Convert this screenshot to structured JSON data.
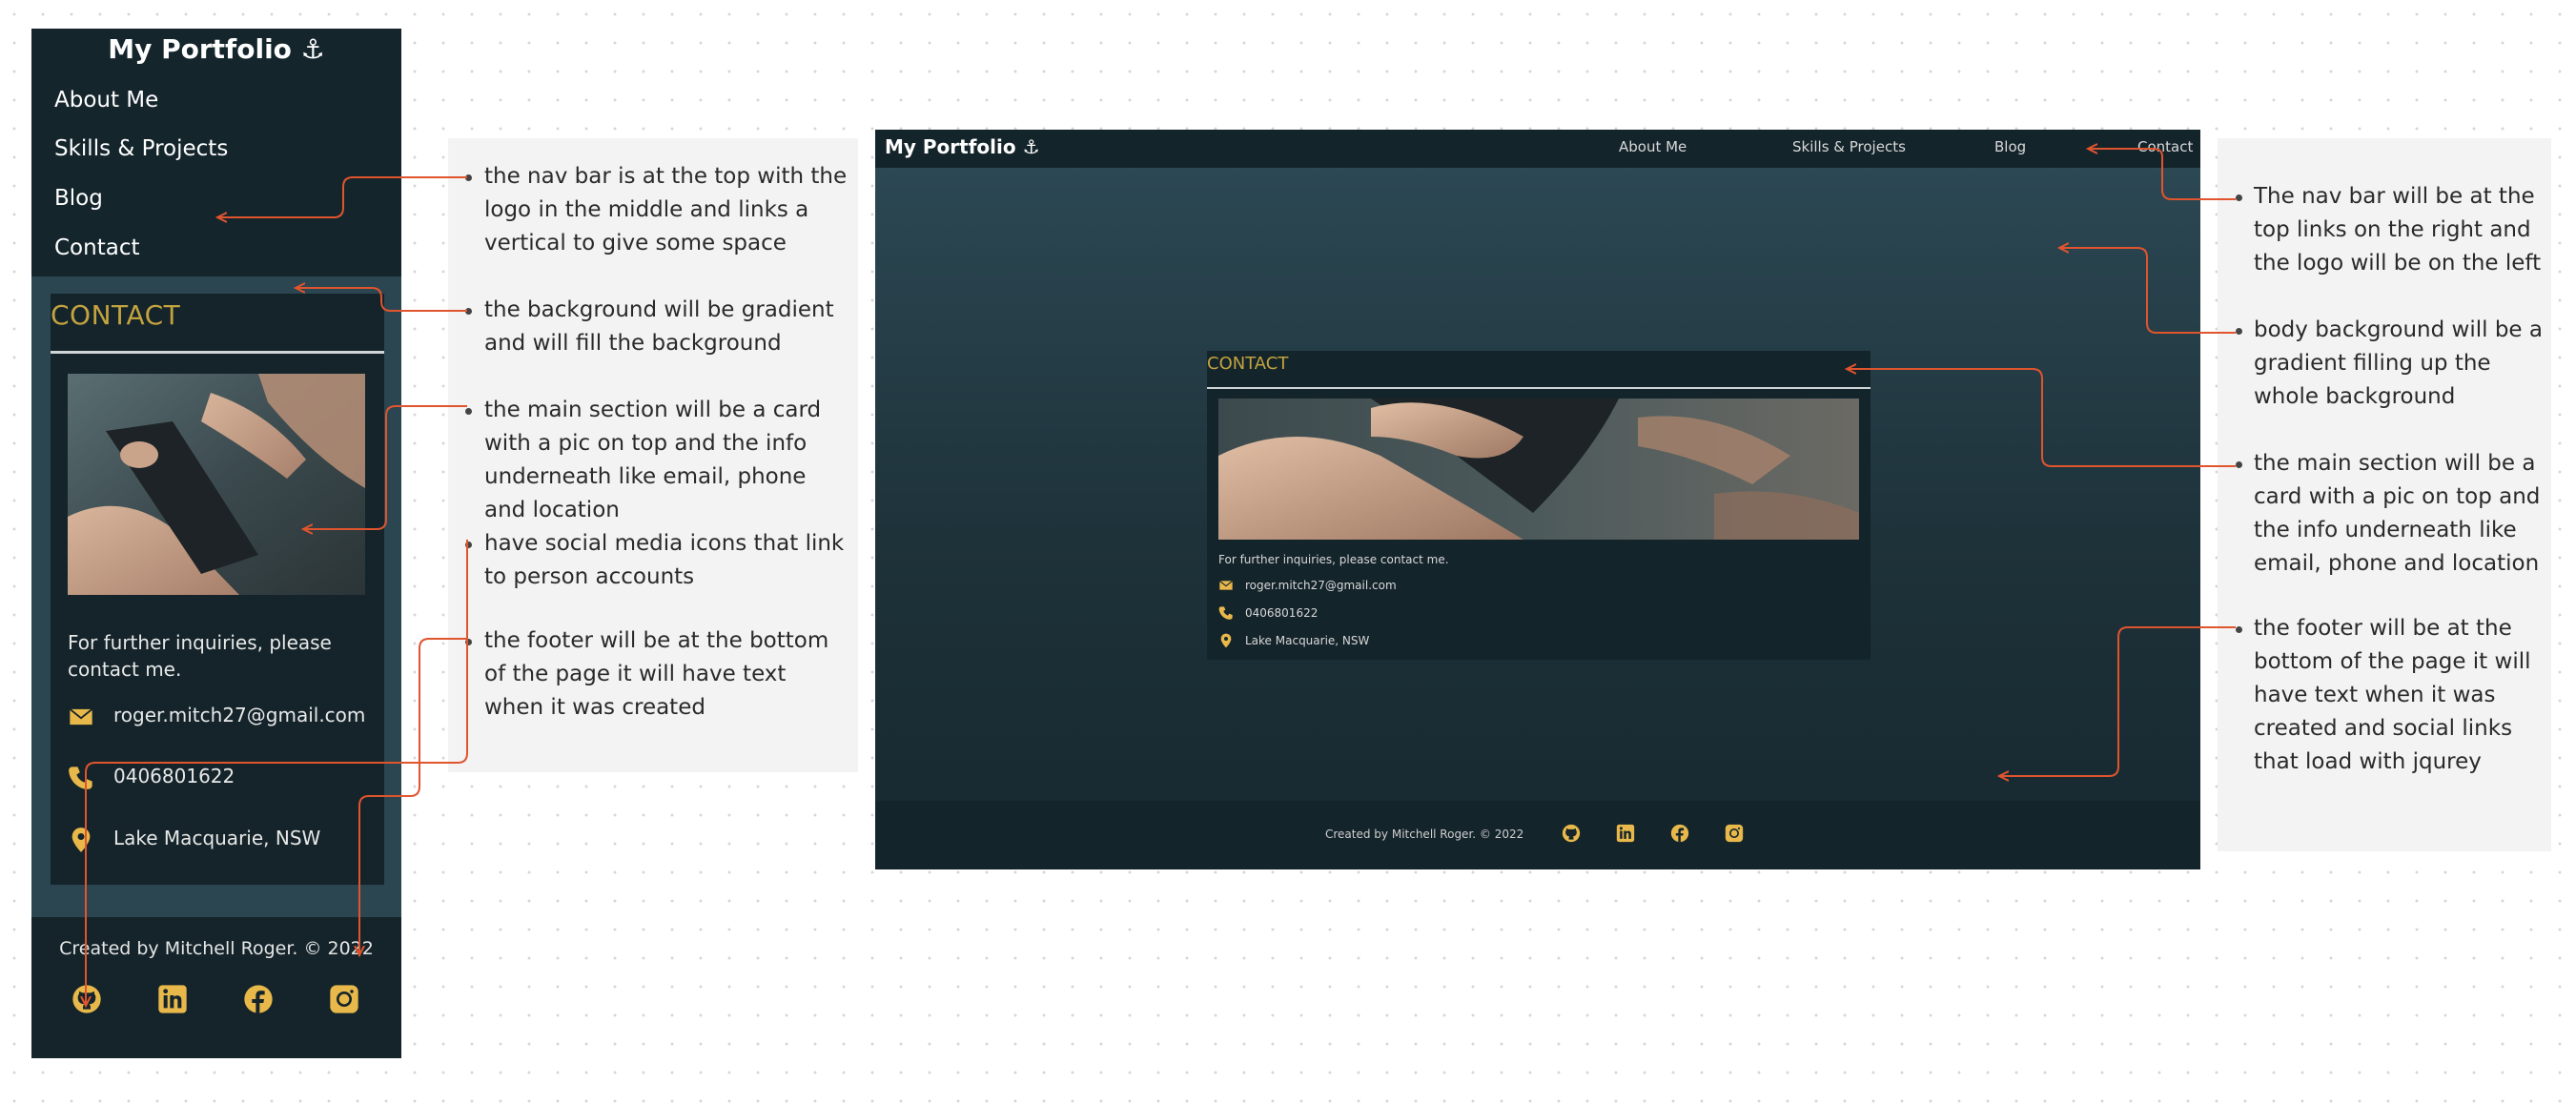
{
  "mobile": {
    "logo": "My Portfolio ⚓",
    "nav": [
      "About Me",
      "Skills & Projects",
      "Blog",
      "Contact"
    ],
    "card_title": "CONTACT",
    "inquiry": "For further inquiries, please contact me.",
    "email": "roger.mitch27@gmail.com",
    "phone": "0406801622",
    "location": "Lake Macquarie, NSW",
    "credit": "Created by Mitchell Roger. © 2022"
  },
  "mobile_notes": [
    "the nav bar is at the top with the logo in the middle and links a vertical to give some space",
    "the background will be gradient and will fill the background",
    "the main section will be a card with a pic on top and the info underneath like email, phone and location",
    "have social media icons that link to person accounts",
    "the footer will be at the bottom of the page it will have text when it was created"
  ],
  "desktop": {
    "logo": "My Portfolio ⚓",
    "nav": [
      "About Me",
      "Skills & Projects",
      "Blog",
      "Contact"
    ],
    "card_title": "CONTACT",
    "inquiry": "For further inquiries, please contact me.",
    "email": "roger.mitch27@gmail.com",
    "phone": "0406801622",
    "location": "Lake Macquarie, NSW",
    "credit": "Created by Mitchell Roger. © 2022"
  },
  "desktop_notes": [
    "The nav bar will be at the top links on the right and the logo will be on the left",
    "body background will be a gradient filling up the whole background",
    "the main section will be a card with a pic on top and the info underneath like email, phone and location",
    "the footer will be at the bottom of the page it will have text when it was created and social links that load with jqurey"
  ],
  "social_icons": [
    "github-icon",
    "linkedin-icon",
    "facebook-icon",
    "instagram-icon"
  ],
  "colors": {
    "accent": "#e8b84a",
    "nav_bg": "#14242b",
    "arrow": "#e0542e",
    "card_title": "#c3a33f"
  }
}
